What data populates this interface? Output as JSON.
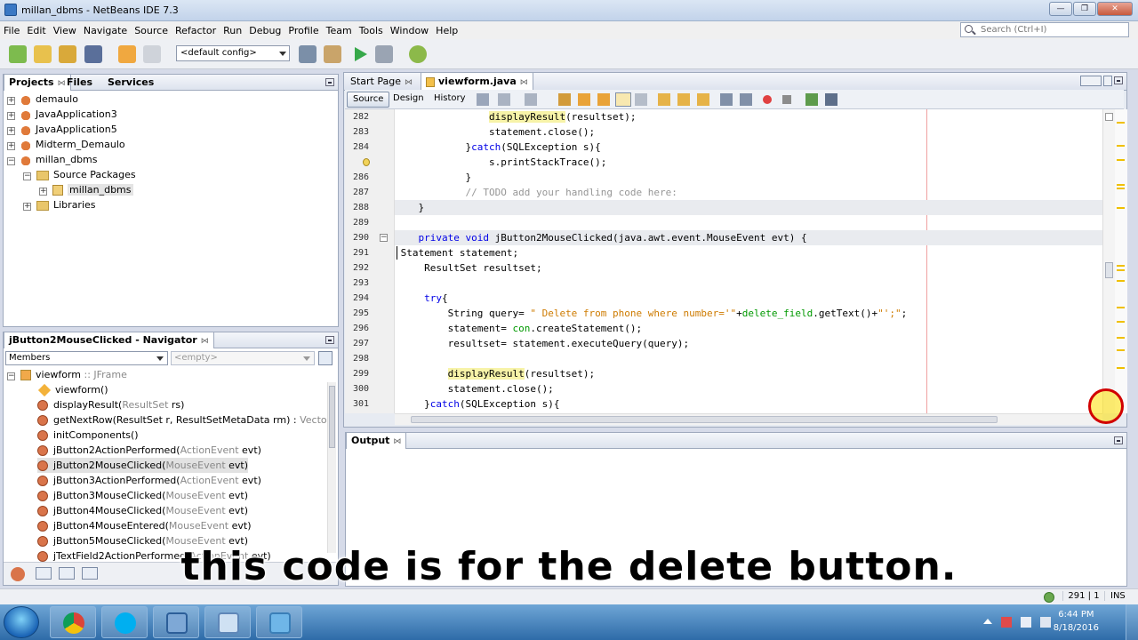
{
  "window": {
    "title": "millan_dbms - NetBeans IDE 7.3"
  },
  "menu": [
    "File",
    "Edit",
    "View",
    "Navigate",
    "Source",
    "Refactor",
    "Run",
    "Debug",
    "Profile",
    "Team",
    "Tools",
    "Window",
    "Help"
  ],
  "search": {
    "placeholder": "Search (Ctrl+I)"
  },
  "toolbar": {
    "config": "<default config>"
  },
  "projects_panel": {
    "tabs": [
      "Projects",
      "Files",
      "Services"
    ],
    "items": [
      "demaulo",
      "JavaApplication3",
      "JavaApplication5",
      "Midterm_Demaulo",
      "millan_dbms",
      "Source Packages",
      "millan_dbms",
      "Libraries"
    ]
  },
  "navigator": {
    "title": "jButton2MouseClicked - Navigator",
    "filter": "Members",
    "filter2": "<empty>",
    "root": "viewform",
    "root_type": ":: JFrame",
    "members": [
      {
        "name": "viewform()",
        "params": ""
      },
      {
        "name": "displayResult(",
        "params": "ResultSet",
        "rest": " rs)"
      },
      {
        "name": "getNextRow(",
        "params": "ResultSet r, ResultSetMetaData rm) :",
        "rest": " Vector"
      },
      {
        "name": "initComponents()",
        "params": ""
      },
      {
        "name": "jButton2ActionPerformed(",
        "params": "ActionEvent",
        "rest": " evt)"
      },
      {
        "name": "jButton2MouseClicked(",
        "params": "MouseEvent",
        "rest": " evt)"
      },
      {
        "name": "jButton3ActionPerformed(",
        "params": "ActionEvent",
        "rest": " evt)"
      },
      {
        "name": "jButton3MouseClicked(",
        "params": "MouseEvent",
        "rest": " evt)"
      },
      {
        "name": "jButton4MouseClicked(",
        "params": "MouseEvent",
        "rest": " evt)"
      },
      {
        "name": "jButton4MouseEntered(",
        "params": "MouseEvent",
        "rest": " evt)"
      },
      {
        "name": "jButton5MouseClicked(",
        "params": "MouseEvent",
        "rest": " evt)"
      },
      {
        "name": "jTextField2ActionPerformed(",
        "params": "ActionEvent",
        "rest": " evt)"
      }
    ]
  },
  "editor": {
    "tabs": [
      {
        "label": "Start Page"
      },
      {
        "label": "viewform.java"
      }
    ],
    "modes": [
      "Source",
      "Design",
      "History"
    ],
    "lines": [
      {
        "n": "282",
        "html": "                <span class=\"mhl\">displayResult</span>(resultset);"
      },
      {
        "n": "283",
        "html": "                statement.close();"
      },
      {
        "n": "284",
        "html": "            }<span class=\"kw\">catch</span>(SQLException s){"
      },
      {
        "n": "",
        "html": "                s.printStackTrace();"
      },
      {
        "n": "286",
        "html": "            }"
      },
      {
        "n": "287",
        "html": "            <span class=\"cm\">// TODO add your handling code here:</span>"
      },
      {
        "n": "288",
        "html": "    }",
        "hl": true
      },
      {
        "n": "289",
        "html": ""
      },
      {
        "n": "290",
        "html": "    <span class=\"kw\">private void</span> jButton2MouseClicked(java.awt.event.MouseEvent evt) {",
        "hl": true
      },
      {
        "n": "291",
        "html": " Statement statement;",
        "caret": true
      },
      {
        "n": "292",
        "html": "     ResultSet resultset;"
      },
      {
        "n": "293",
        "html": ""
      },
      {
        "n": "294",
        "html": "     <span class=\"kw\">try</span>{"
      },
      {
        "n": "295",
        "html": "         String query= <span class=\"str\">\" Delete from phone where number='\"</span>+<span class=\"fld\">delete_field</span>.getText()+<span class=\"str\">\"';\"</span>;"
      },
      {
        "n": "296",
        "html": "         statement= <span class=\"fld\">con</span>.createStatement();"
      },
      {
        "n": "297",
        "html": "         resultset= statement.executeQuery(query);"
      },
      {
        "n": "298",
        "html": ""
      },
      {
        "n": "299",
        "html": "         <span class=\"mhl\">displayResult</span>(resultset);"
      },
      {
        "n": "300",
        "html": "         statement.close();"
      },
      {
        "n": "301",
        "html": "     }<span class=\"kw\">catch</span>(SQLException s){"
      },
      {
        "n": "",
        "html": "         s.printStackTrace();"
      }
    ]
  },
  "output": {
    "title": "Output"
  },
  "status": {
    "position": "291 | 1",
    "mode": "INS"
  },
  "subtitle": "this code is for the delete button.",
  "taskbar": {
    "time": "6:44 PM",
    "date": "8/18/2016"
  }
}
